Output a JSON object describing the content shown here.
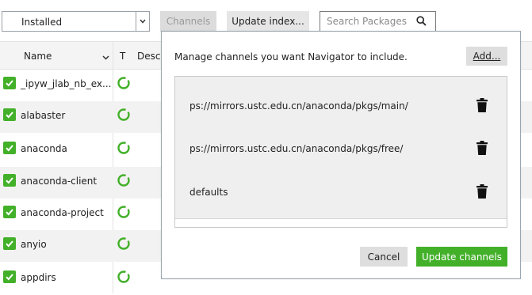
{
  "toolbar": {
    "filter_value": "Installed",
    "channels_label": "Channels",
    "update_index_label": "Update index...",
    "search_placeholder": "Search Packages"
  },
  "table": {
    "columns": {
      "name": "Name",
      "type": "T",
      "description": "Desc"
    },
    "rows": [
      {
        "name": "_ipyw_jlab_nb_ex...",
        "checked": true
      },
      {
        "name": "alabaster",
        "checked": true
      },
      {
        "name": "anaconda",
        "checked": true
      },
      {
        "name": "anaconda-client",
        "checked": true
      },
      {
        "name": "anaconda-project",
        "checked": true
      },
      {
        "name": "anyio",
        "checked": true
      },
      {
        "name": "appdirs",
        "checked": true
      }
    ]
  },
  "dialog": {
    "title": "Manage channels you want Navigator to include.",
    "add_label": "Add...",
    "channels": [
      "ps://mirrors.ustc.edu.cn/anaconda/pkgs/main/",
      "ps://mirrors.ustc.edu.cn/anaconda/pkgs/free/",
      "defaults"
    ],
    "cancel_label": "Cancel",
    "update_label": "Update channels"
  },
  "icons": {
    "search": "search-icon",
    "dropdown": "chevron-down-icon",
    "checkbox": "checkbox-checked-icon",
    "status": "status-ring-icon",
    "delete": "trash-icon"
  },
  "colors": {
    "accent_green": "#43b02a",
    "status_ring": "#43b02a",
    "button_grey": "#dedede",
    "list_background": "#efefef"
  }
}
